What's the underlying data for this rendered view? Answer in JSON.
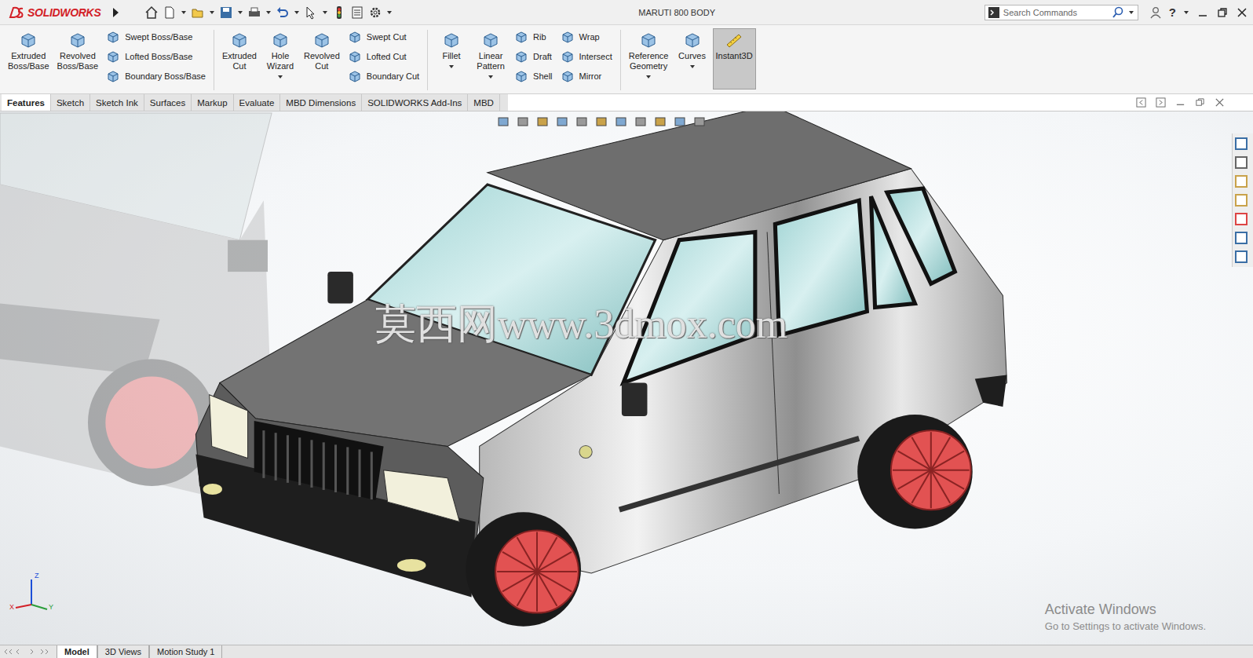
{
  "app": {
    "brand": "SOLIDWORKS",
    "title": "MARUTI 800 BODY",
    "search_placeholder": "Search Commands",
    "help": "?"
  },
  "ribbon": {
    "groups": [
      {
        "items": [
          {
            "kind": "big",
            "lines": [
              "Extruded",
              "Boss/Base"
            ],
            "dropdown": false,
            "selected": false
          },
          {
            "kind": "big",
            "lines": [
              "Revolved",
              "Boss/Base"
            ],
            "dropdown": false,
            "selected": false
          },
          {
            "kind": "stack",
            "items": [
              "Swept Boss/Base",
              "Lofted Boss/Base",
              "Boundary Boss/Base"
            ]
          }
        ]
      },
      {
        "items": [
          {
            "kind": "big",
            "lines": [
              "Extruded",
              "Cut"
            ],
            "dropdown": false,
            "selected": false
          },
          {
            "kind": "big",
            "lines": [
              "Hole",
              "Wizard"
            ],
            "dropdown": true,
            "selected": false
          },
          {
            "kind": "big",
            "lines": [
              "Revolved",
              "Cut"
            ],
            "dropdown": false,
            "selected": false
          },
          {
            "kind": "stack",
            "items": [
              "Swept Cut",
              "Lofted Cut",
              "Boundary Cut"
            ]
          }
        ]
      },
      {
        "items": [
          {
            "kind": "big",
            "lines": [
              "Fillet"
            ],
            "dropdown": true,
            "selected": false
          },
          {
            "kind": "big",
            "lines": [
              "Linear",
              "Pattern"
            ],
            "dropdown": true,
            "selected": false
          },
          {
            "kind": "stack",
            "items": [
              "Rib",
              "Draft",
              "Shell"
            ]
          },
          {
            "kind": "stack",
            "items": [
              "Wrap",
              "Intersect",
              "Mirror"
            ]
          }
        ]
      },
      {
        "items": [
          {
            "kind": "big",
            "lines": [
              "Reference",
              "Geometry"
            ],
            "dropdown": true,
            "selected": false
          },
          {
            "kind": "big",
            "lines": [
              "Curves"
            ],
            "dropdown": true,
            "selected": false
          },
          {
            "kind": "big",
            "lines": [
              "Instant3D"
            ],
            "dropdown": false,
            "selected": true
          }
        ]
      }
    ]
  },
  "tabs": [
    {
      "label": "Features",
      "selected": true
    },
    {
      "label": "Sketch",
      "selected": false
    },
    {
      "label": "Sketch Ink",
      "selected": false
    },
    {
      "label": "Surfaces",
      "selected": false
    },
    {
      "label": "Markup",
      "selected": false
    },
    {
      "label": "Evaluate",
      "selected": false
    },
    {
      "label": "MBD Dimensions",
      "selected": false
    },
    {
      "label": "SOLIDWORKS Add-Ins",
      "selected": false
    },
    {
      "label": "MBD",
      "selected": false
    }
  ],
  "viewport": {
    "watermark": "莫西网www.3dmox.com",
    "axes": [
      "Z",
      "X",
      "Y"
    ]
  },
  "activation": {
    "title": "Activate Windows",
    "subtitle": "Go to Settings to activate Windows."
  },
  "bottom_tabs": [
    {
      "label": "Model",
      "selected": true
    },
    {
      "label": "3D Views",
      "selected": false
    },
    {
      "label": "Motion Study 1",
      "selected": false
    }
  ]
}
